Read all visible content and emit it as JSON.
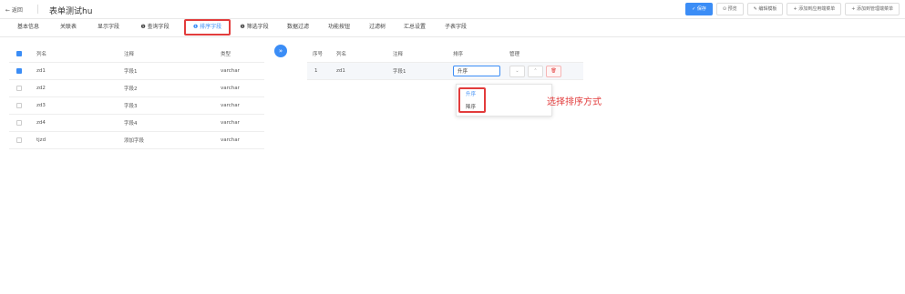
{
  "header": {
    "back_label": "← 返回",
    "title": "表单测试hu",
    "buttons": {
      "save": "✓ 保存",
      "preview": "⊙ 预览",
      "edit_template": "✎ 编辑模板",
      "add_app_menu": "+ 添加到应用端菜单",
      "add_admin_menu": "+ 添加到管理端菜单"
    }
  },
  "tabs": [
    "基本信息",
    "关联表",
    "显示字段",
    "❶ 查询字段",
    "❶ 排序字段",
    "❶ 筛选字段",
    "数据过滤",
    "功能按钮",
    "过滤树",
    "汇总设置",
    "子表字段"
  ],
  "left_table": {
    "headers": [
      "列名",
      "注释",
      "类型"
    ],
    "rows": [
      {
        "name": "zd1",
        "comment": "字段1",
        "type": "varchar",
        "checked": true
      },
      {
        "name": "zd2",
        "comment": "字段2",
        "type": "varchar",
        "checked": false
      },
      {
        "name": "zd3",
        "comment": "字段3",
        "type": "varchar",
        "checked": false
      },
      {
        "name": "zd4",
        "comment": "字段4",
        "type": "varchar",
        "checked": false
      },
      {
        "name": "tjzd",
        "comment": "添加字段",
        "type": "varchar",
        "checked": false
      }
    ]
  },
  "move_icon": "»",
  "right_table": {
    "headers": [
      "序号",
      "列名",
      "注释",
      "排序",
      "管理"
    ],
    "row": {
      "index": "1",
      "name": "zd1",
      "comment": "字段1",
      "sort": "升序"
    },
    "actions": {
      "down": "⌄",
      "up": "⌃",
      "delete": "🗑"
    }
  },
  "sort_dropdown": {
    "options": [
      "升序",
      "降序"
    ]
  },
  "annotation": "选择排序方式",
  "colors": {
    "accent": "#3b8df6",
    "highlight": "#e23c3c"
  }
}
